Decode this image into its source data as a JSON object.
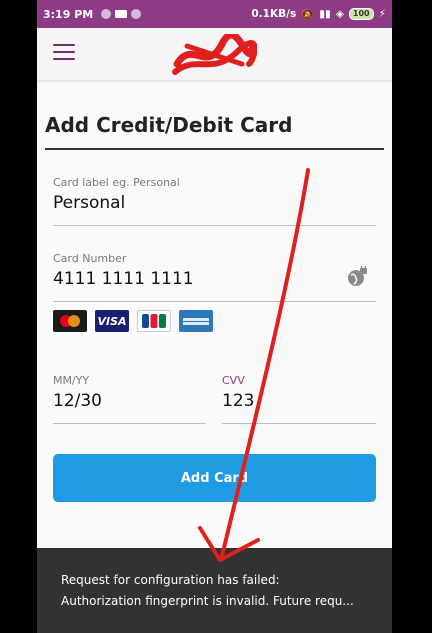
{
  "status_bar": {
    "time": "3:19 PM",
    "network_speed": "0.1KB/s",
    "battery": "100"
  },
  "app_bar": {
    "menu_icon": "hamburger-icon",
    "logo": "redacted-logo"
  },
  "page": {
    "title": "Add Credit/Debit Card"
  },
  "form": {
    "card_label": {
      "label": "Card label eg. Personal",
      "value": "Personal"
    },
    "card_number": {
      "label": "Card Number",
      "value": "4111 1111 1111"
    },
    "expiry": {
      "label": "MM/YY",
      "value": "12/30"
    },
    "cvv": {
      "label": "CVV",
      "value": "123"
    },
    "card_brands": [
      "mastercard",
      "visa",
      "jcb",
      "american-express"
    ],
    "submit_label": "Add Card"
  },
  "snackbar": {
    "line1": "Request for configuration has failed:",
    "line2": "Authorization fingerprint is invalid. Future requ..."
  },
  "colors": {
    "status_bar": "#8e3b86",
    "button": "#1e9be3",
    "snackbar": "#323232",
    "annotation_arrow": "#e0201f"
  }
}
